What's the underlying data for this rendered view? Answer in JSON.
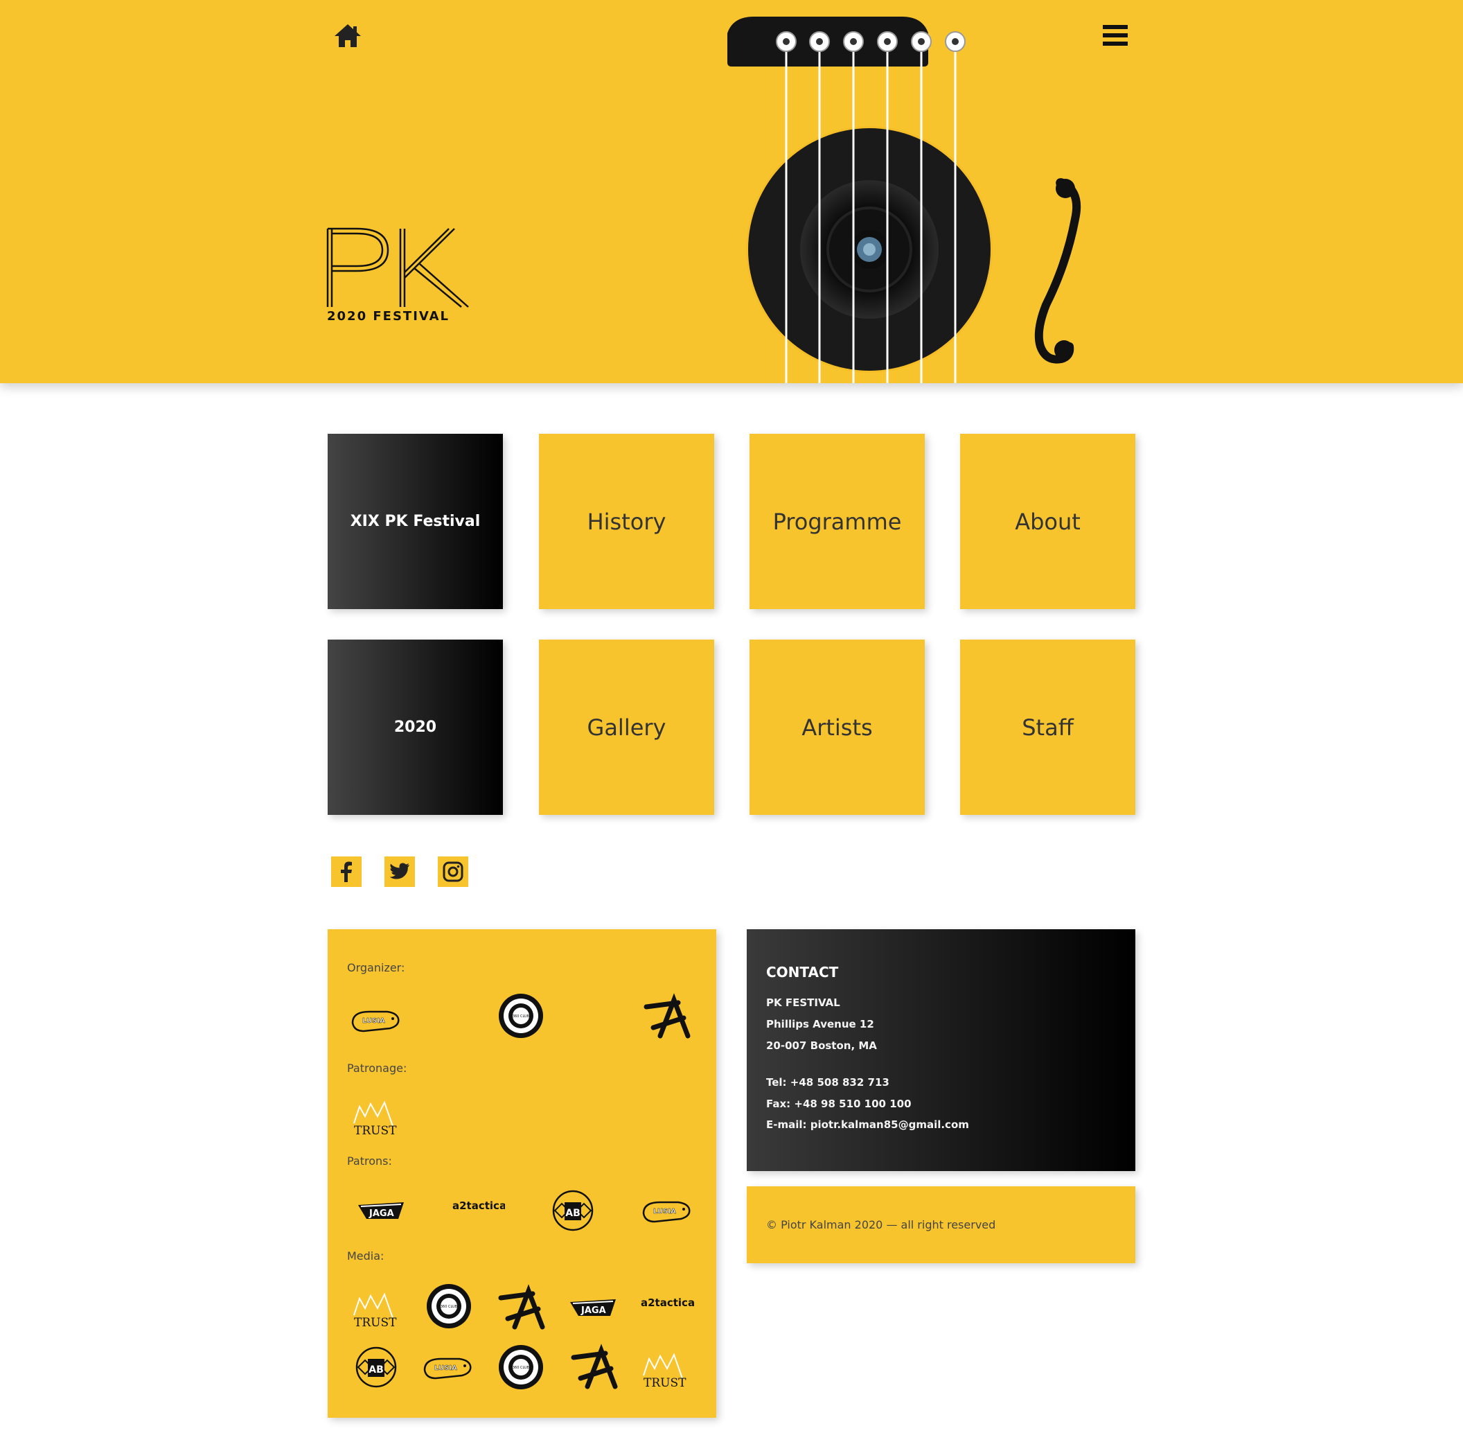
{
  "colors": {
    "accent": "#f8c42d",
    "dark": "#000000",
    "text": "#333333"
  },
  "hero": {
    "logo_letters": "PK",
    "logo_subtitle": "2020 FESTIVAL",
    "home_icon": "home-icon",
    "menu_icon": "hamburger-menu-icon"
  },
  "tiles": [
    {
      "label": "XIX PK Festival",
      "style": "dark"
    },
    {
      "label": "History",
      "style": "yellow"
    },
    {
      "label": "Programme",
      "style": "yellow"
    },
    {
      "label": "About",
      "style": "yellow"
    },
    {
      "label": "2020",
      "style": "dark"
    },
    {
      "label": "Gallery",
      "style": "yellow"
    },
    {
      "label": "Artists",
      "style": "yellow"
    },
    {
      "label": "Staff",
      "style": "yellow"
    }
  ],
  "social": [
    "facebook-icon",
    "twitter-icon",
    "instagram-icon"
  ],
  "sponsors": {
    "organizer_label": "Organizer:",
    "patronage_label": "Patronage:",
    "patrons_label": "Patrons:",
    "media_label": "Media:",
    "logo_texts": {
      "lusia": "LUSIA",
      "club": "360 CLUB",
      "trust": "TRUST",
      "jaga": "JAGA",
      "a2tactica": "a2tactica",
      "ab": "AB"
    }
  },
  "contact": {
    "title": "CONTACT",
    "name": "PK FESTIVAL",
    "street": "Phillips Avenue 12",
    "city": "20-007 Boston, MA",
    "tel": "Tel: +48 508 832 713",
    "fax": "Fax: +48 98 510 100 100",
    "email": "E-mail: piotr.kalman85@gmail.com"
  },
  "footer": {
    "copyright": "© Piotr Kalman 2020 — all right reserved"
  }
}
